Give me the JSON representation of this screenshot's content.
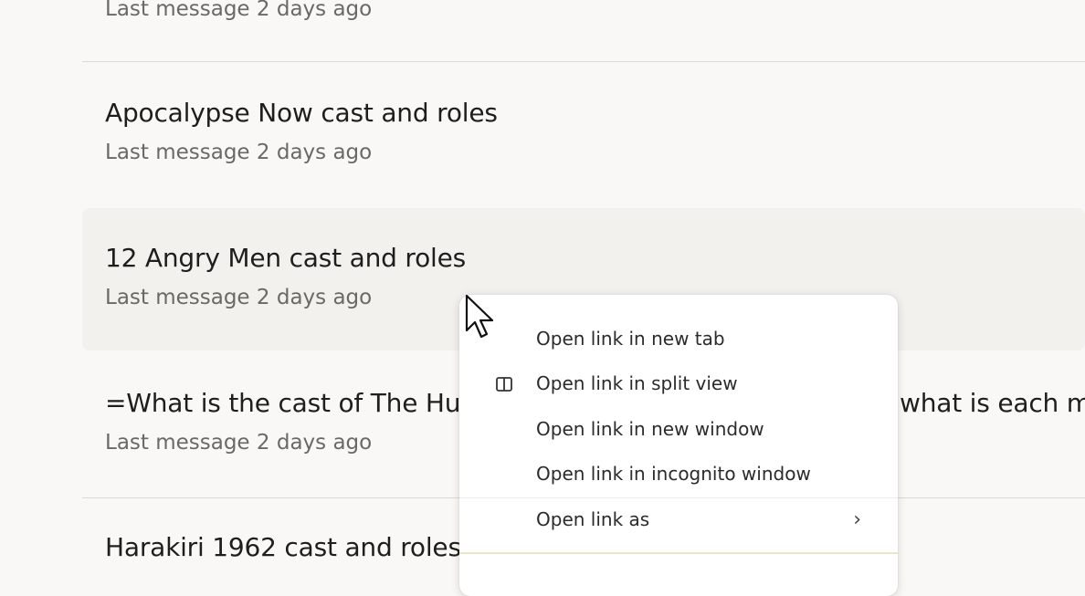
{
  "conversations": [
    {
      "title": "",
      "subtitle": "Last message 2 days ago"
    },
    {
      "title": "Apocalypse Now cast and roles",
      "subtitle": "Last message 2 days ago"
    },
    {
      "title": "12 Angry Men cast and roles",
      "subtitle": "Last message 2 days ago"
    },
    {
      "title": "=What is the cast of The Hu",
      "title_tail": "what is each m",
      "subtitle": "Last message 2 days ago"
    },
    {
      "title": "Harakiri 1962 cast and roles",
      "subtitle": ""
    }
  ],
  "context_menu": {
    "items": [
      {
        "label": "Open link in new tab",
        "icon": ""
      },
      {
        "label": "Open link in split view",
        "icon": "split-view-icon"
      },
      {
        "label": "Open link in new window",
        "icon": ""
      },
      {
        "label": "Open link in incognito window",
        "icon": ""
      },
      {
        "label": "Open link as",
        "icon": "",
        "submenu": true,
        "chevron": "›"
      }
    ]
  },
  "colors": {
    "background": "#faf8f6",
    "highlight_row": "#f3f1ee",
    "divider": "#dcd9d4",
    "subtitle_text": "#6b6964",
    "menu_background": "#ffffff"
  }
}
